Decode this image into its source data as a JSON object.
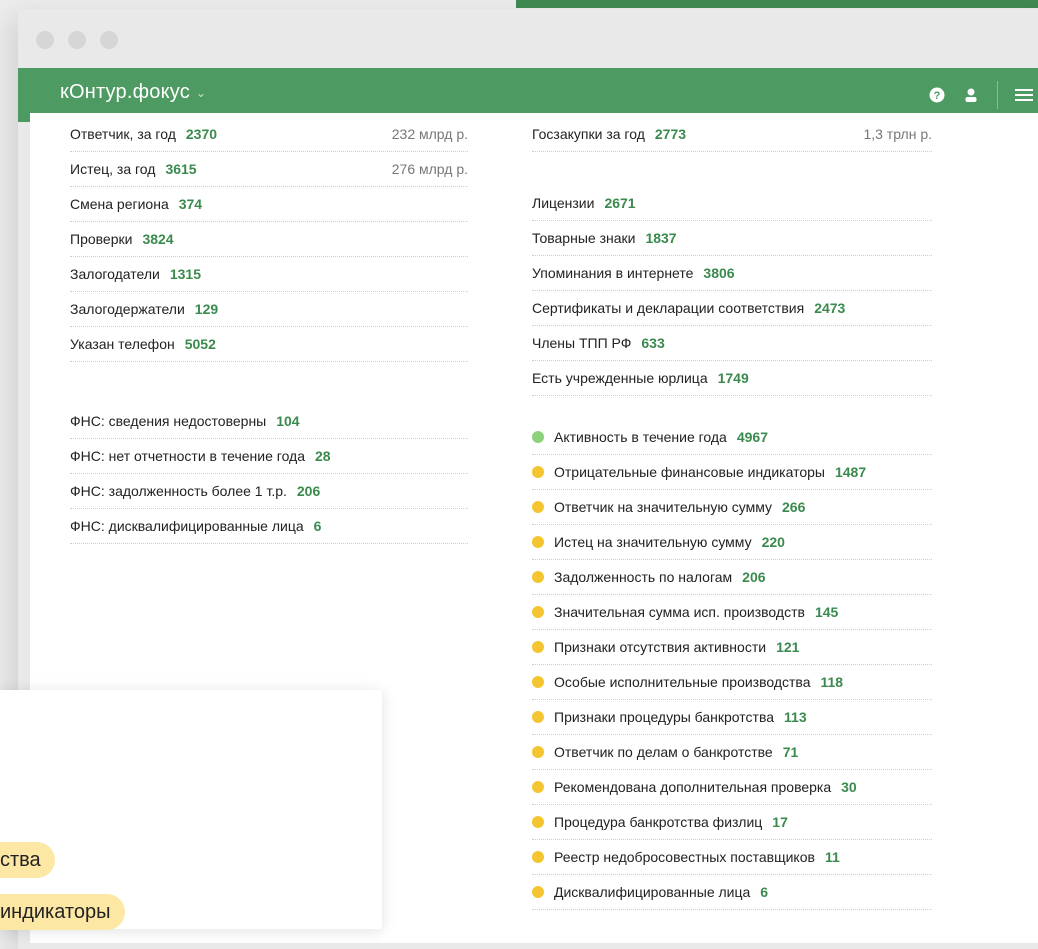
{
  "app": {
    "logo": "кОнтур.фокус",
    "logo_chevron": "⌄"
  },
  "colors": {
    "brand_green": "#4e9a63",
    "number_green": "#3a8a4e",
    "status_green": "#8dd17a",
    "status_yellow": "#f4c531",
    "pill_yellow": "#fde7a5"
  },
  "navbar": {
    "icons": [
      "help-icon",
      "user-icon",
      "menu-icon"
    ]
  },
  "left": {
    "group1": [
      {
        "label": "Ответчик, за год",
        "count": "2370",
        "amount": "232 млрд р."
      },
      {
        "label": "Истец, за год",
        "count": "3615",
        "amount": "276 млрд р."
      },
      {
        "label": "Смена региона",
        "count": "374"
      },
      {
        "label": "Проверки",
        "count": "3824"
      },
      {
        "label": "Залогодатели",
        "count": "1315"
      },
      {
        "label": "Залогодержатели",
        "count": "129"
      },
      {
        "label": "Указан телефон",
        "count": "5052"
      }
    ],
    "group2": [
      {
        "label": "ФНС: сведения недостоверны",
        "count": "104"
      },
      {
        "label": "ФНС: нет отчетности в течение года",
        "count": "28"
      },
      {
        "label": "ФНС: задолженность более 1 т.р.",
        "count": "206"
      },
      {
        "label": "ФНС: дисквалифицированные лица",
        "count": "6"
      }
    ]
  },
  "right": {
    "group1": [
      {
        "label": "Госзакупки за год",
        "count": "2773",
        "amount": "1,3 трлн р."
      }
    ],
    "group2": [
      {
        "label": "Лицензии",
        "count": "2671"
      },
      {
        "label": "Товарные знаки",
        "count": "1837"
      },
      {
        "label": "Упоминания в интернете",
        "count": "3806"
      },
      {
        "label": "Сертификаты и декларации соответствия",
        "count": "2473"
      },
      {
        "label": "Члены ТПП РФ",
        "count": "633"
      },
      {
        "label": "Есть учрежденные юрлица",
        "count": "1749"
      }
    ],
    "indicators": [
      {
        "label": "Активность в течение года",
        "count": "4967",
        "status": "green"
      },
      {
        "label": "Отрицательные финансовые индикаторы",
        "count": "1487",
        "status": "yellow"
      },
      {
        "label": "Ответчик на значительную сумму",
        "count": "266",
        "status": "yellow"
      },
      {
        "label": "Истец на значительную сумму",
        "count": "220",
        "status": "yellow"
      },
      {
        "label": "Задолженность по налогам",
        "count": "206",
        "status": "yellow"
      },
      {
        "label": "Значительная сумма исп. производств",
        "count": "145",
        "status": "yellow"
      },
      {
        "label": "Признаки отсутствия активности",
        "count": "121",
        "status": "yellow"
      },
      {
        "label": "Особые исполнительные производства",
        "count": "118",
        "status": "yellow"
      },
      {
        "label": "Признаки процедуры банкротства",
        "count": "113",
        "status": "yellow"
      },
      {
        "label": "Ответчик по делам о банкротстве",
        "count": "71",
        "status": "yellow"
      },
      {
        "label": "Рекомендована дополнительная проверка",
        "count": "30",
        "status": "yellow"
      },
      {
        "label": "Процедура банкротства физлиц",
        "count": "17",
        "status": "yellow"
      },
      {
        "label": "Реестр недобросовестных поставщиков",
        "count": "11",
        "status": "yellow"
      },
      {
        "label": "Дисквалифицированные лица",
        "count": "6",
        "status": "yellow"
      }
    ]
  },
  "overlay": {
    "pills": [
      "ства",
      "индикаторы"
    ]
  }
}
